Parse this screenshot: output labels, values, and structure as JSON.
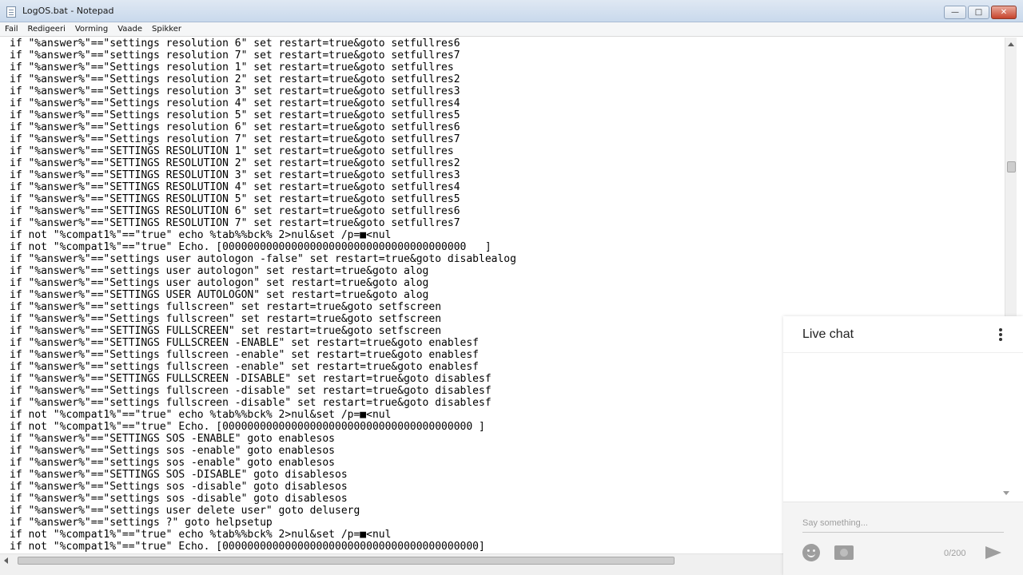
{
  "window": {
    "title": "LogOS.bat - Notepad",
    "min_label": "—",
    "max_label": "□",
    "close_label": "✕"
  },
  "menu": [
    "Fail",
    "Redigeeri",
    "Vorming",
    "Vaade",
    "Spikker"
  ],
  "editor": {
    "lines": [
      "if \"%answer%\"==\"settings resolution 6\" set restart=true&goto setfullres6",
      "if \"%answer%\"==\"settings resolution 7\" set restart=true&goto setfullres7",
      "if \"%answer%\"==\"Settings resolution 1\" set restart=true&goto setfullres",
      "if \"%answer%\"==\"Settings resolution 2\" set restart=true&goto setfullres2",
      "if \"%answer%\"==\"Settings resolution 3\" set restart=true&goto setfullres3",
      "if \"%answer%\"==\"Settings resolution 4\" set restart=true&goto setfullres4",
      "if \"%answer%\"==\"Settings resolution 5\" set restart=true&goto setfullres5",
      "if \"%answer%\"==\"Settings resolution 6\" set restart=true&goto setfullres6",
      "if \"%answer%\"==\"Settings resolution 7\" set restart=true&goto setfullres7",
      "if \"%answer%\"==\"SETTINGS RESOLUTION 1\" set restart=true&goto setfullres",
      "if \"%answer%\"==\"SETTINGS RESOLUTION 2\" set restart=true&goto setfullres2",
      "if \"%answer%\"==\"SETTINGS RESOLUTION 3\" set restart=true&goto setfullres3",
      "if \"%answer%\"==\"SETTINGS RESOLUTION 4\" set restart=true&goto setfullres4",
      "if \"%answer%\"==\"SETTINGS RESOLUTION 5\" set restart=true&goto setfullres5",
      "if \"%answer%\"==\"SETTINGS RESOLUTION 6\" set restart=true&goto setfullres6",
      "if \"%answer%\"==\"SETTINGS RESOLUTION 7\" set restart=true&goto setfullres7",
      "if not \"%compat1%\"==\"true\" echo %tab%%bck% 2>nul&set /p=■<nul",
      "if not \"%compat1%\"==\"true\" Echo. [000000000000000000000000000000000000000   ]",
      "if \"%answer%\"==\"settings user autologon -false\" set restart=true&goto disablealog",
      "if \"%answer%\"==\"settings user autologon\" set restart=true&goto alog",
      "if \"%answer%\"==\"Settings user autologon\" set restart=true&goto alog",
      "if \"%answer%\"==\"SETTINGS USER AUTOLOGON\" set restart=true&goto alog",
      "if \"%answer%\"==\"settings fullscreen\" set restart=true&goto setfscreen",
      "if \"%answer%\"==\"Settings fullscreen\" set restart=true&goto setfscreen",
      "if \"%answer%\"==\"SETTINGS FULLSCREEN\" set restart=true&goto setfscreen",
      "if \"%answer%\"==\"SETTINGS FULLSCREEN -ENABLE\" set restart=true&goto enablesf",
      "if \"%answer%\"==\"Settings fullscreen -enable\" set restart=true&goto enablesf",
      "if \"%answer%\"==\"settings fullscreen -enable\" set restart=true&goto enablesf",
      "if \"%answer%\"==\"SETTINGS FULLSCREEN -DISABLE\" set restart=true&goto disablesf",
      "if \"%answer%\"==\"Settings fullscreen -disable\" set restart=true&goto disablesf",
      "if \"%answer%\"==\"settings fullscreen -disable\" set restart=true&goto disablesf",
      "if not \"%compat1%\"==\"true\" echo %tab%%bck% 2>nul&set /p=■<nul",
      "if not \"%compat1%\"==\"true\" Echo. [0000000000000000000000000000000000000000 ]",
      "if \"%answer%\"==\"SETTINGS SOS -ENABLE\" goto enablesos",
      "if \"%answer%\"==\"Settings sos -enable\" goto enablesos",
      "if \"%answer%\"==\"settings sos -enable\" goto enablesos",
      "if \"%answer%\"==\"SETTINGS SOS -DISABLE\" goto disablesos",
      "if \"%answer%\"==\"Settings sos -disable\" goto disablesos",
      "if \"%answer%\"==\"settings sos -disable\" goto disablesos",
      "if \"%answer%\"==\"settings user delete user\" goto deluserg",
      "if \"%answer%\"==\"settings ?\" goto helpsetup",
      "if not \"%compat1%\"==\"true\" echo %tab%%bck% 2>nul&set /p=■<nul",
      "if not \"%compat1%\"==\"true\" Echo. [00000000000000000000000000000000000000000]"
    ]
  },
  "chat": {
    "title": "Live chat",
    "placeholder": "Say something...",
    "char_count": "0/200"
  }
}
